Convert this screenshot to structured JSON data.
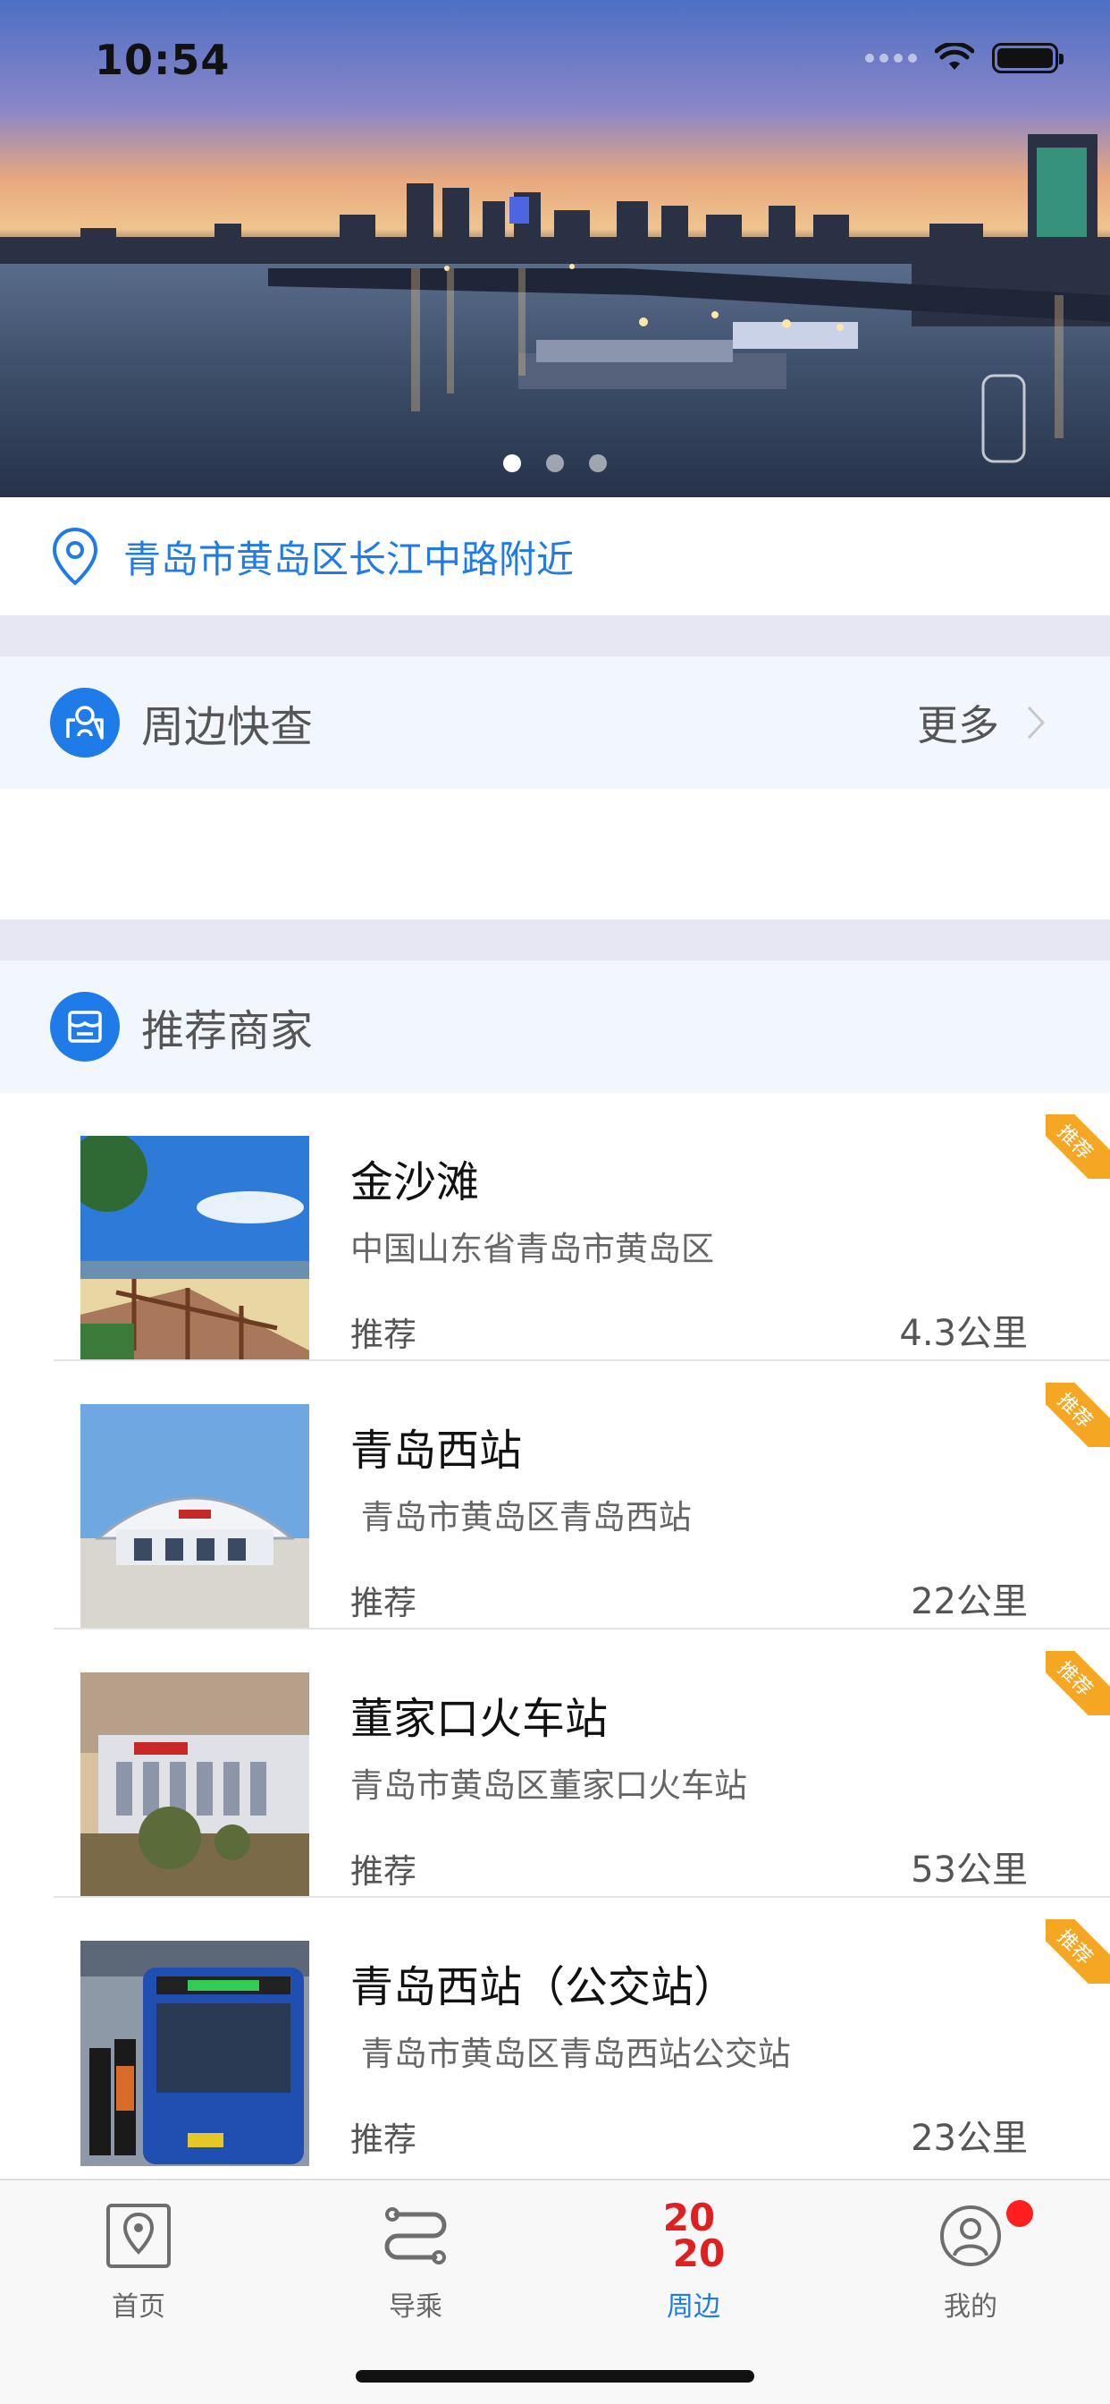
{
  "status_bar": {
    "time": "10:54"
  },
  "location": {
    "text": "青岛市黄岛区长江中路附近"
  },
  "quick_search": {
    "title": "周边快查",
    "more_label": "更多"
  },
  "merchants": {
    "title": "推荐商家",
    "ribbon_label": "推荐",
    "items": [
      {
        "name": "金沙滩",
        "address": "中国山东省青岛市黄岛区",
        "tag": "推荐",
        "distance": "4.3公里"
      },
      {
        "name": "青岛西站",
        "address": " 青岛市黄岛区青岛西站",
        "tag": "推荐",
        "distance": "22公里"
      },
      {
        "name": "董家口火车站",
        "address": "青岛市黄岛区董家口火车站",
        "tag": "推荐",
        "distance": "53公里"
      },
      {
        "name": "青岛西站（公交站）",
        "address": " 青岛市黄岛区青岛西站公交站",
        "tag": "推荐",
        "distance": "23公里"
      }
    ]
  },
  "tabbar": {
    "items": [
      {
        "label": "首页"
      },
      {
        "label": "导乘"
      },
      {
        "label": "周边",
        "logo_top": "20",
        "logo_bottom": "20"
      },
      {
        "label": "我的"
      }
    ]
  },
  "colors": {
    "accent": "#1f7be8",
    "ribbon": "#f5a623",
    "badge": "#ff1f1f",
    "logo": "#e02020"
  }
}
